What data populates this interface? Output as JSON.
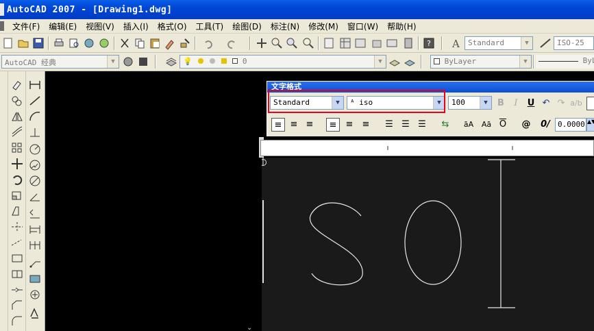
{
  "window": {
    "title": "AutoCAD 2007 - [Drawing1.dwg]"
  },
  "menu": {
    "items": [
      "文件(F)",
      "编辑(E)",
      "视图(V)",
      "插入(I)",
      "格式(O)",
      "工具(T)",
      "绘图(D)",
      "标注(N)",
      "修改(M)",
      "窗口(W)",
      "帮助(H)"
    ]
  },
  "toolbar": {
    "text_style_combo": "Standard",
    "dim_style_combo": "ISO-25"
  },
  "workspace": {
    "combo": "AutoCAD 经典",
    "layer_combo": "0",
    "color_combo": "ByLayer",
    "linetype_combo": "ByL"
  },
  "text_formatting": {
    "title": "文字格式",
    "style": "Standard",
    "font": "iso",
    "height": "100",
    "oblique": "0.0000",
    "bold": "B",
    "italic": "I",
    "underline": "U",
    "at_symbol": "@",
    "oblique_symbol": "0/"
  },
  "editor": {
    "content": "iso"
  },
  "colors": {
    "title_bar": "#0046d6",
    "highlight": "#e8001c",
    "canvas": "#000000"
  }
}
